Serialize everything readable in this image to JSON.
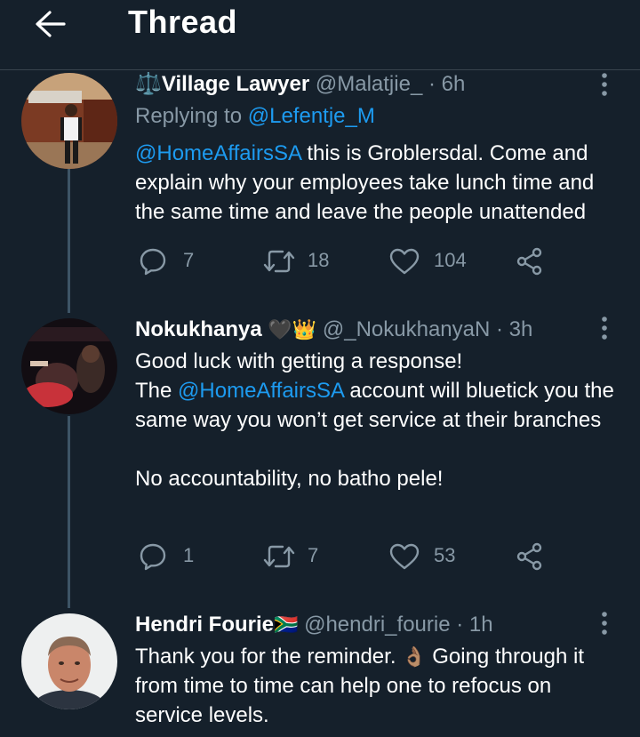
{
  "header": {
    "title": "Thread"
  },
  "tweets": [
    {
      "name": "⚖️Village Lawyer",
      "handle": "@Malatjie_",
      "dot": "·",
      "time": "6h",
      "reply_prefix": "Replying to",
      "reply_to": "@Lefentje_M",
      "mention": "@HomeAffairsSA",
      "text_rest": " this is Groblersdal. Come and explain why your employees take lunch time and the same time and leave the people unattended",
      "replies": "7",
      "retweets": "18",
      "likes": "104"
    },
    {
      "name": "Nokukhanya",
      "name_emoji": "🖤👑",
      "handle": "@_NokukhanyaN",
      "dot": "·",
      "time": "3h",
      "line1": "Good luck with getting a response!",
      "line2_pre": "The ",
      "mention": "@HomeAffairsSA",
      "line2_rest": " account will bluetick you the same way you won’t get service at their branches",
      "line3": "No accountability, no batho pele!",
      "replies": "1",
      "retweets": "7",
      "likes": "53"
    },
    {
      "name": "Hendri Fourie",
      "name_emoji": "🇿🇦",
      "handle": "@hendri_fourie",
      "dot": "·",
      "time": "1h",
      "text_pre": "Thank you for the reminder. ",
      "text_emoji": "👌🏽",
      "text_rest": " Going through it from time to time can help one to refocus on service levels."
    }
  ],
  "colors": {
    "background": "#15202b",
    "secondary_text": "#8899a6",
    "link": "#1d9bf0",
    "divider": "#38444d"
  },
  "icons": [
    "back-arrow-icon",
    "more-icon",
    "reply-icon",
    "retweet-icon",
    "like-icon",
    "share-icon"
  ]
}
